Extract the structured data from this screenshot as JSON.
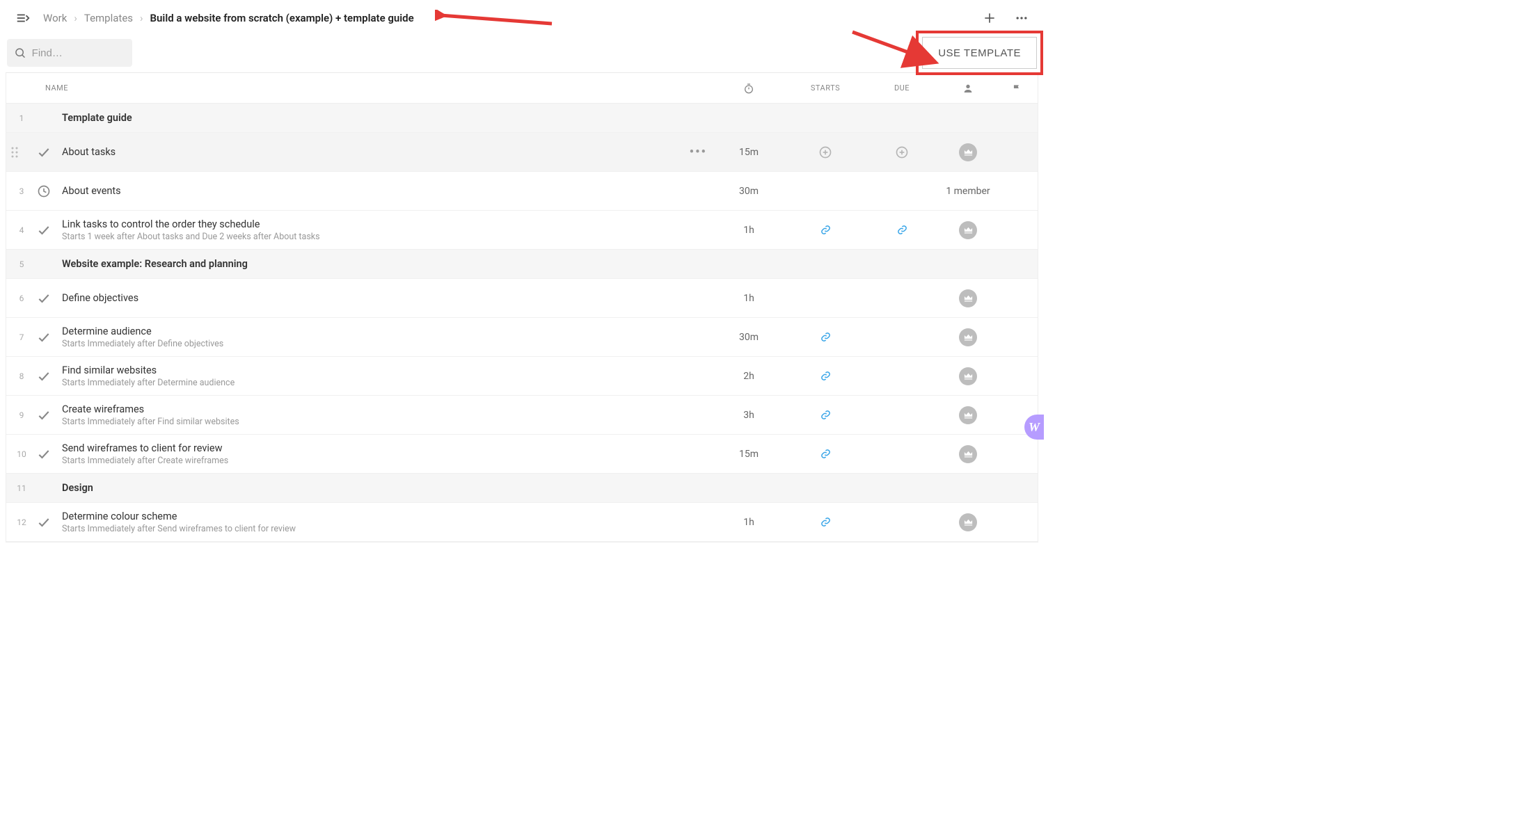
{
  "breadcrumbs": {
    "items": [
      "Work",
      "Templates"
    ],
    "current": "Build a website from scratch (example) + template guide"
  },
  "search": {
    "placeholder": "Find…"
  },
  "buttons": {
    "use_template": "USE TEMPLATE"
  },
  "columns": {
    "name": "NAME",
    "duration_icon": "stopwatch-icon",
    "starts": "STARTS",
    "due": "DUE",
    "assignee_icon": "person-icon",
    "flag_icon": "flag-icon"
  },
  "rows": [
    {
      "num": "1",
      "type": "section",
      "title": "Template guide"
    },
    {
      "num": "",
      "type": "task",
      "selected": true,
      "icon": "check",
      "title": "About tasks",
      "duration": "15m",
      "starts": "plus",
      "due": "plus",
      "assignee": "crown",
      "actions": true,
      "drag": true
    },
    {
      "num": "3",
      "type": "task",
      "icon": "clock",
      "title": "About events",
      "duration": "30m",
      "assignee_text": "1 member"
    },
    {
      "num": "4",
      "type": "task",
      "icon": "check",
      "title": "Link tasks to control the order they schedule",
      "subtitle": "Starts 1 week after About tasks and Due 2 weeks after About tasks",
      "duration": "1h",
      "starts": "link",
      "due": "link",
      "assignee": "crown"
    },
    {
      "num": "5",
      "type": "section",
      "title": "Website example: Research and planning"
    },
    {
      "num": "6",
      "type": "task",
      "icon": "check",
      "title": "Define objectives",
      "duration": "1h",
      "assignee": "crown"
    },
    {
      "num": "7",
      "type": "task",
      "icon": "check",
      "title": "Determine audience",
      "subtitle": "Starts Immediately after Define objectives",
      "duration": "30m",
      "starts": "link",
      "assignee": "crown"
    },
    {
      "num": "8",
      "type": "task",
      "icon": "check",
      "title": "Find similar websites",
      "subtitle": "Starts Immediately after Determine audience",
      "duration": "2h",
      "starts": "link",
      "assignee": "crown"
    },
    {
      "num": "9",
      "type": "task",
      "icon": "check",
      "title": "Create wireframes",
      "subtitle": "Starts Immediately after Find similar websites",
      "duration": "3h",
      "starts": "link",
      "assignee": "crown"
    },
    {
      "num": "10",
      "type": "task",
      "icon": "check",
      "title": "Send wireframes to client for review",
      "subtitle": "Starts Immediately after Create wireframes",
      "duration": "15m",
      "starts": "link",
      "assignee": "crown"
    },
    {
      "num": "11",
      "type": "section",
      "title": "Design"
    },
    {
      "num": "12",
      "type": "task",
      "icon": "check",
      "title": "Determine colour scheme",
      "subtitle": "Starts Immediately after Send wireframes to client for review",
      "duration": "1h",
      "starts": "link",
      "assignee": "crown"
    }
  ],
  "side_tab": "W",
  "annotations": {
    "arrow_color": "#e53935",
    "highlight_color": "#e53935"
  }
}
